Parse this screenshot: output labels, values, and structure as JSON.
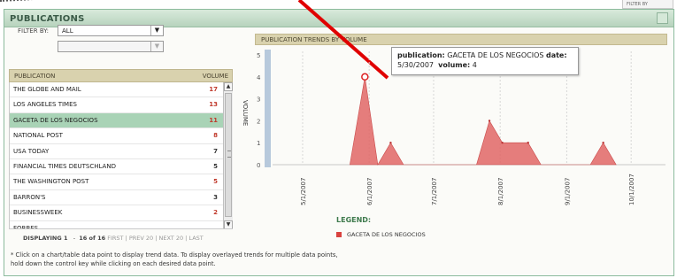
{
  "background": {
    "filter_label": "FILTER BY"
  },
  "panel": {
    "title": "PUBLICATIONS"
  },
  "filter": {
    "label": "FILTER BY:",
    "selected": "ALL",
    "secondary": ""
  },
  "table": {
    "headers": [
      "PUBLICATION",
      "VOLUME"
    ],
    "rows": [
      {
        "publication": "THE GLOBE AND MAIL",
        "volume": "17",
        "color": "#c0392b"
      },
      {
        "publication": "LOS ANGELES TIMES",
        "volume": "13",
        "color": "#c0392b"
      },
      {
        "publication": "GACETA DE LOS NEGOCIOS",
        "volume": "11",
        "color": "#c0392b",
        "selected": true
      },
      {
        "publication": "NATIONAL POST",
        "volume": "8",
        "color": "#c0392b"
      },
      {
        "publication": "USA TODAY",
        "volume": "7",
        "color": "#333333"
      },
      {
        "publication": "FINANCIAL TIMES DEUTSCHLAND",
        "volume": "5",
        "color": "#333333"
      },
      {
        "publication": "THE WASHINGTON POST",
        "volume": "5",
        "color": "#c0392b"
      },
      {
        "publication": "BARRON'S",
        "volume": "3",
        "color": "#333333"
      },
      {
        "publication": "BUSINESSWEEK",
        "volume": "2",
        "color": "#c0392b"
      },
      {
        "publication": "FORBES",
        "volume": "",
        "color": "#333333"
      }
    ]
  },
  "pager": {
    "displaying": "DISPLAYING 1",
    "sep": "-",
    "range": "16 of 16",
    "first": "FIRST",
    "prev": "PREV 20",
    "next": "NEXT 20",
    "last": "LAST"
  },
  "note": "* Click on a chart/table data point to display trend data.  To display overlayed trends for multiple data points, hold down the control key while clicking on each desired data point.",
  "chart": {
    "heading": "PUBLICATION TRENDS BY VOLUME",
    "legend_title": "LEGEND:",
    "legend_item": "GACETA DE LOS NEGOCIOS",
    "tooltip": {
      "pub_label": "publication:",
      "pub_value": "GACETA DE LOS NEGOCIOS",
      "date_label": "date:",
      "date_value": "5/30/2007",
      "vol_label": "volume:",
      "vol_value": "4"
    }
  },
  "chart_data": {
    "type": "area",
    "title": "PUBLICATION TRENDS BY VOLUME",
    "ylabel": "VOLUME",
    "xlabel": "",
    "ylim": [
      0,
      5
    ],
    "yticks": [
      0,
      1,
      2,
      3,
      4,
      5
    ],
    "xticks": [
      "5/1/2007",
      "6/1/2007",
      "7/1/2007",
      "8/1/2007",
      "9/1/2007",
      "10/1/2007"
    ],
    "xlim": [
      "4/17/2007",
      "10/17/2007"
    ],
    "legend": "bottom-left",
    "series": [
      {
        "name": "GACETA DE LOS NEGOCIOS",
        "color": "#e06666",
        "points": [
          {
            "x": "5/23/2007",
            "y": 0
          },
          {
            "x": "5/30/2007",
            "y": 4
          },
          {
            "x": "6/5/2007",
            "y": 0
          },
          {
            "x": "6/11/2007",
            "y": 1
          },
          {
            "x": "6/17/2007",
            "y": 0
          },
          {
            "x": "7/21/2007",
            "y": 0
          },
          {
            "x": "7/27/2007",
            "y": 2
          },
          {
            "x": "8/2/2007",
            "y": 1
          },
          {
            "x": "8/14/2007",
            "y": 1
          },
          {
            "x": "8/20/2007",
            "y": 0
          },
          {
            "x": "9/12/2007",
            "y": 0
          },
          {
            "x": "9/18/2007",
            "y": 1
          },
          {
            "x": "9/24/2007",
            "y": 0
          }
        ]
      }
    ]
  }
}
